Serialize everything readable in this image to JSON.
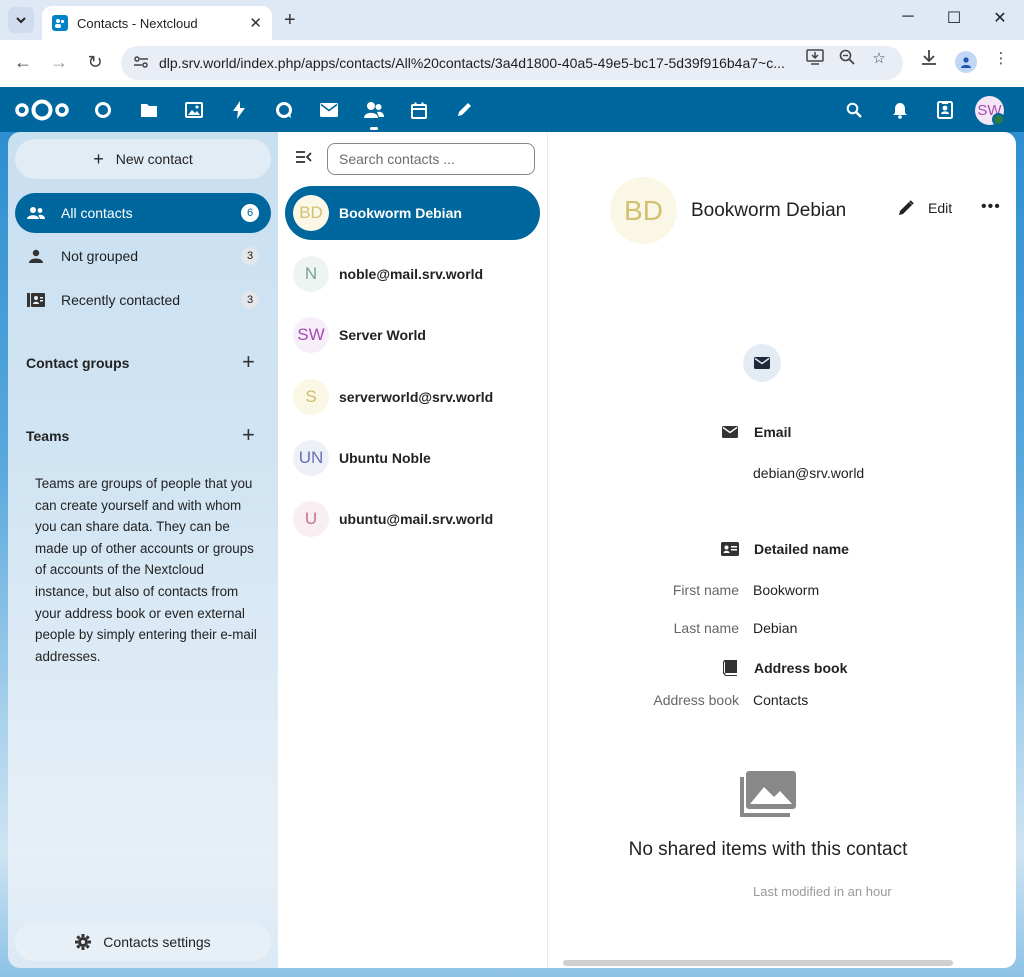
{
  "browser": {
    "tab_title": "Contacts - Nextcloud",
    "url": "dlp.srv.world/index.php/apps/contacts/All%20contacts/3a4d1800-40a5-49e5-bc17-5d39f916b4a7~c...",
    "new_tab": "+",
    "tab_close": "✕",
    "minimize": "─",
    "maximize": "☐",
    "close": "✕"
  },
  "header": {
    "user_initials": "SW",
    "apps": [
      "dashboard-icon",
      "files-icon",
      "photos-icon",
      "activity-icon",
      "talk-icon",
      "mail-icon",
      "contacts-icon",
      "calendar-icon",
      "notes-icon"
    ],
    "brand_color": "#00679e"
  },
  "sidebar": {
    "new_contact": "New contact",
    "items": [
      {
        "label": "All contacts",
        "count": "6",
        "icon": "group-icon"
      },
      {
        "label": "Not grouped",
        "count": "3",
        "icon": "person-icon"
      },
      {
        "label": "Recently contacted",
        "count": "3",
        "icon": "recent-icon"
      }
    ],
    "contact_groups": "Contact groups",
    "teams": "Teams",
    "teams_description": "Teams are groups of people that you can create yourself and with whom you can share data. They can be made up of other accounts or groups of accounts of the Nextcloud instance, but also of contacts from your address book or even external people by simply entering their e-mail addresses.",
    "settings": "Contacts settings",
    "add": "+"
  },
  "list": {
    "search_placeholder": "Search contacts ...",
    "contacts": [
      {
        "initials": "BD",
        "name": "Bookworm Debian",
        "bg": "#faf7e6",
        "fg": "#d3c06f"
      },
      {
        "initials": "N",
        "name": "noble@mail.srv.world",
        "bg": "#eef4f1",
        "fg": "#7aa594"
      },
      {
        "initials": "SW",
        "name": "Server World",
        "bg": "#f6eef8",
        "fg": "#a54bb2"
      },
      {
        "initials": "S",
        "name": "serverworld@srv.world",
        "bg": "#fbf7e5",
        "fg": "#d3b96a"
      },
      {
        "initials": "UN",
        "name": "Ubuntu Noble",
        "bg": "#eef0f7",
        "fg": "#6a6fb4"
      },
      {
        "initials": "U",
        "name": "ubuntu@mail.srv.world",
        "bg": "#f9eef2",
        "fg": "#c0758b"
      }
    ]
  },
  "details": {
    "initials": "BD",
    "name": "Bookworm Debian",
    "edit": "Edit",
    "more": "•••",
    "email_heading": "Email",
    "email": "debian@srv.world",
    "detailed_name_heading": "Detailed name",
    "first_name_label": "First name",
    "first_name": "Bookworm",
    "last_name_label": "Last name",
    "last_name": "Debian",
    "address_book_heading": "Address book",
    "address_book_label": "Address book",
    "address_book": "Contacts",
    "empty_text": "No shared items with this contact",
    "last_modified": "Last modified in an hour"
  }
}
